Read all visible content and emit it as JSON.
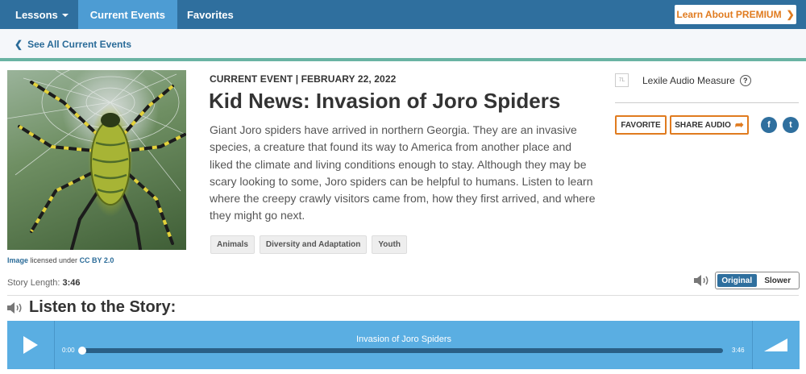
{
  "nav": {
    "items": [
      {
        "label": "Lessons"
      },
      {
        "label": "Current Events"
      },
      {
        "label": "Favorites"
      }
    ],
    "premium_label": "Learn About PREMIUM"
  },
  "subbar": {
    "back_label": "See All Current Events"
  },
  "image": {
    "credit_link": "Image",
    "credit_text": " licensed under ",
    "license_link": "CC BY 2.0"
  },
  "article": {
    "kicker": "CURRENT EVENT | FEBRUARY 22, 2022",
    "title": "Kid News: Invasion of Joro Spiders",
    "description": "Giant Joro spiders have arrived in northern Georgia. They are an invasive species, a creature that found its way to America from another place and liked the climate and living conditions enough to stay. Although they may be scary looking to some, Joro spiders can be helpful to humans. Listen to learn where the creepy crawly visitors came from, how they first arrived, and where they might go next.",
    "tags": [
      "Animals",
      "Diversity and Adaptation",
      "Youth"
    ]
  },
  "sidebar": {
    "lexile_badge": "7L",
    "lexile_label": "Lexile Audio Measure",
    "help": "?",
    "favorite_label": "FAVORITE",
    "share_label": "SHARE AUDIO",
    "facebook": "f",
    "twitter": "t"
  },
  "story": {
    "length_label": "Story Length:",
    "length_value": "3:46",
    "speed_options": [
      "Original",
      "Slower"
    ],
    "speed_selected": "Original"
  },
  "listen": {
    "heading": "Listen to the Story:"
  },
  "player": {
    "track_title": "Invasion of Joro Spiders",
    "time_current": "0:00",
    "time_total": "3:46",
    "progress": 0
  },
  "colors": {
    "nav_bg": "#2f6f9e",
    "nav_active": "#4d9cd3",
    "accent_orange": "#e07b1f",
    "link_blue": "#2a6b98",
    "player_bg": "#5aaee2",
    "divider_teal": "#6ab3a3"
  },
  "icons": [
    "chevron-left-icon",
    "chevron-right-icon",
    "share-arrow-icon",
    "speaker-icon",
    "play-icon",
    "volume-icon",
    "facebook-icon",
    "twitter-icon"
  ]
}
